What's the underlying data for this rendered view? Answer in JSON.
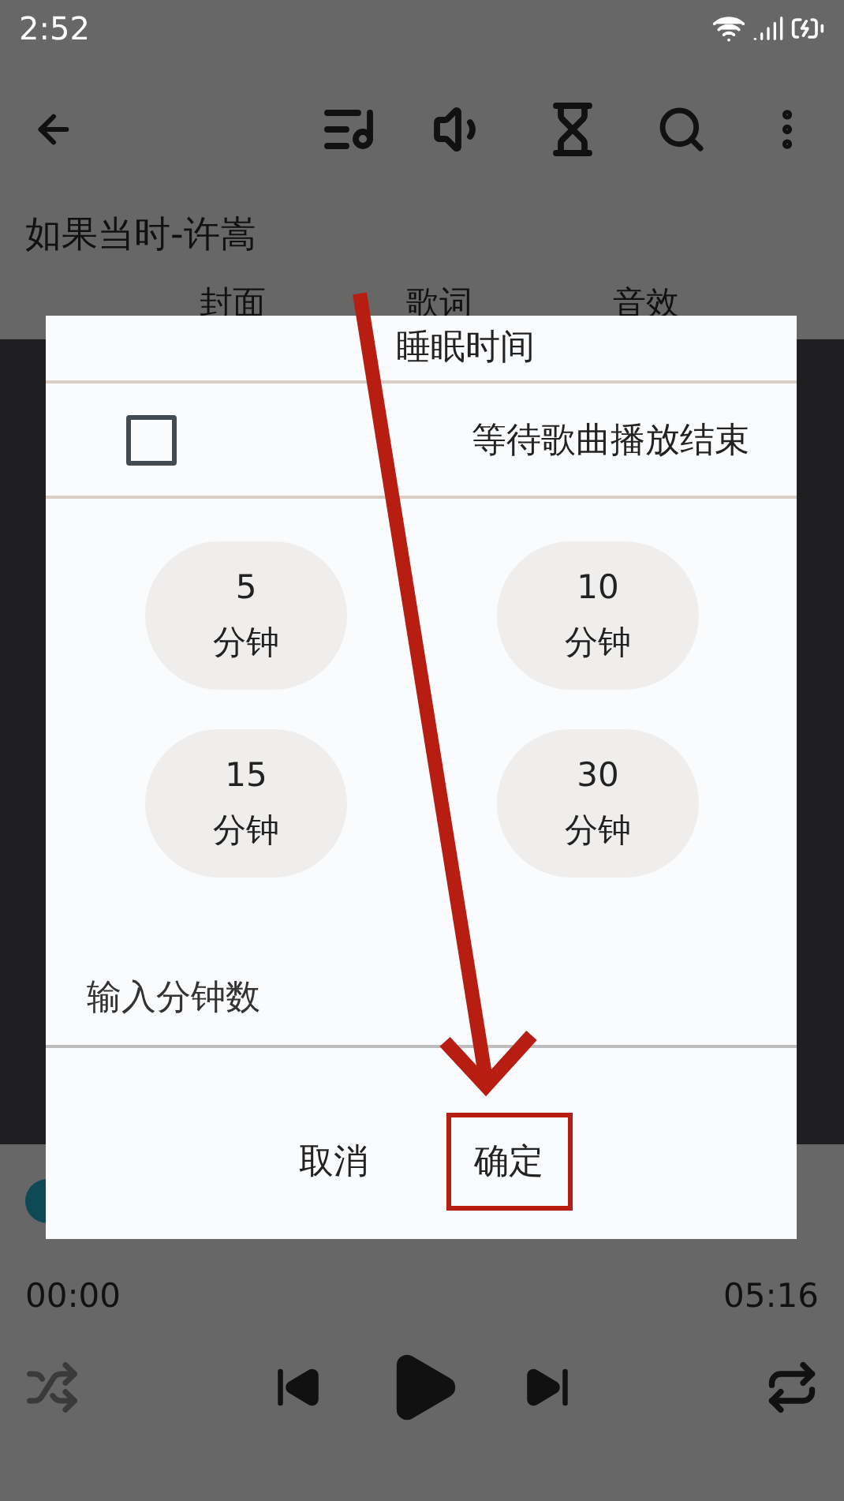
{
  "status_bar": {
    "time": "2:52"
  },
  "song_title": "如果当时-许嵩",
  "tabs": [
    {
      "label": "封面"
    },
    {
      "label": "歌词"
    },
    {
      "label": "音效"
    }
  ],
  "player": {
    "position": "00:00",
    "duration": "05:16"
  },
  "dialog": {
    "title": "睡眠时间",
    "wait_option": {
      "label": "等待歌曲播放结束",
      "checked": false
    },
    "presets": [
      {
        "value": "5",
        "unit": "分钟"
      },
      {
        "value": "10",
        "unit": "分钟"
      },
      {
        "value": "15",
        "unit": "分钟"
      },
      {
        "value": "30",
        "unit": "分钟"
      }
    ],
    "input": {
      "placeholder": "输入分钟数"
    },
    "buttons": [
      {
        "label": "取消",
        "highlighted": false
      },
      {
        "label": "确定",
        "highlighted": true
      }
    ]
  }
}
